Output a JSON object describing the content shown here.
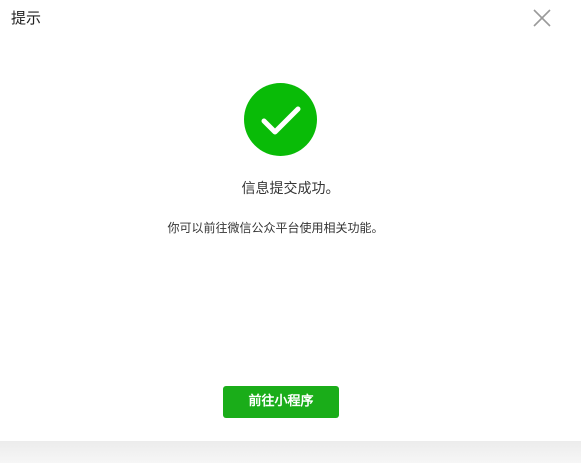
{
  "dialog": {
    "title": "提示",
    "close_icon": "close-icon"
  },
  "status": {
    "icon": "success-check-icon",
    "icon_color": "#09bb07",
    "title": "信息提交成功。",
    "description": "你可以前往微信公众平台使用相关功能。"
  },
  "actions": {
    "primary_label": "前往小程序",
    "primary_color": "#1aad19"
  }
}
